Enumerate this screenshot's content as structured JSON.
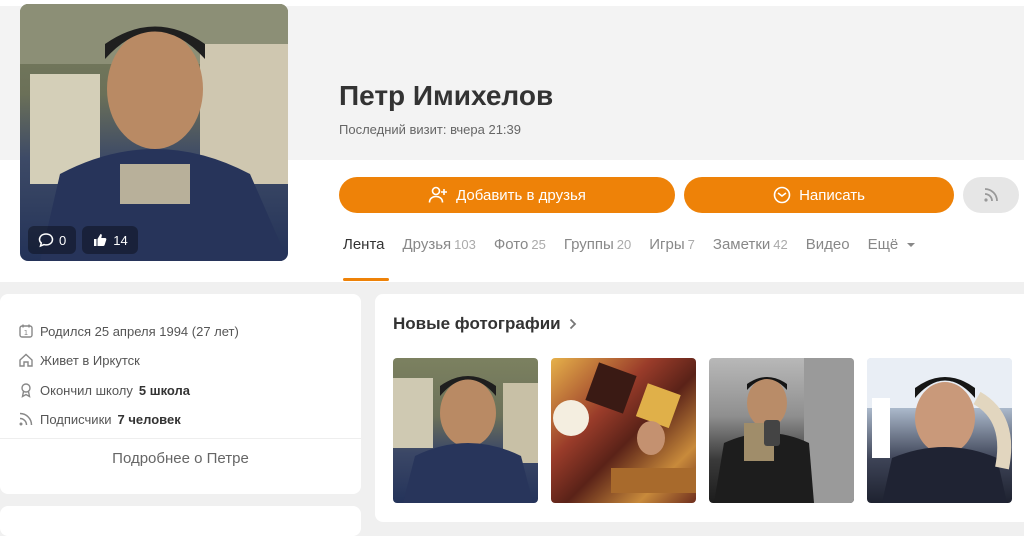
{
  "profile": {
    "name": "Петр Имихелов",
    "last_visit": "Последний визит: вчера 21:39",
    "comments_count": "0",
    "likes_count": "14"
  },
  "actions": {
    "add_friend": "Добавить в друзья",
    "write": "Написать"
  },
  "tabs": [
    {
      "label": "Лента",
      "count": ""
    },
    {
      "label": "Друзья",
      "count": "103"
    },
    {
      "label": "Фото",
      "count": "25"
    },
    {
      "label": "Группы",
      "count": "20"
    },
    {
      "label": "Игры",
      "count": "7"
    },
    {
      "label": "Заметки",
      "count": "42"
    },
    {
      "label": "Видео",
      "count": ""
    },
    {
      "label": "Ещё",
      "count": ""
    }
  ],
  "info": {
    "born": "Родился 25 апреля 1994 (27 лет)",
    "lives": "Живет в Иркутск",
    "school_prefix": "Окончил школу",
    "school_name": "5 школа",
    "subscribers_prefix": "Подписчики",
    "subscribers_value": "7 человек",
    "more": "Подробнее о Петре"
  },
  "photos": {
    "title": "Новые фотографии"
  },
  "colors": {
    "accent": "#ee8208",
    "page_bg": "#f0f0f0"
  }
}
